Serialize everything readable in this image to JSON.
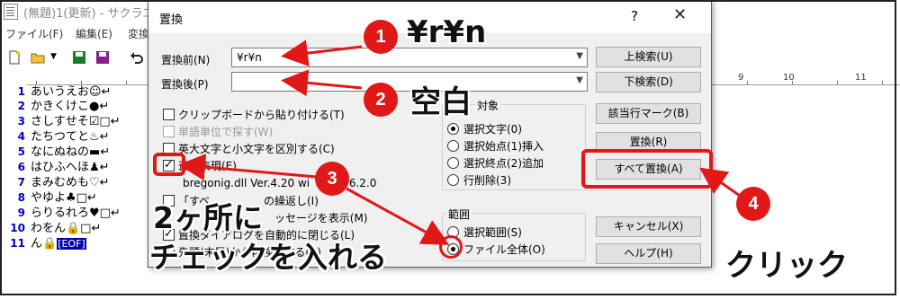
{
  "editor": {
    "title": "(無題)1(更新) - サクラエ",
    "menu": [
      "ファイル(F)",
      "編集(E)",
      "変換"
    ],
    "ruler": [
      "9",
      "10",
      "11"
    ],
    "line_numbers": [
      "1",
      "2",
      "3",
      "4",
      "5",
      "6",
      "7",
      "8",
      "9",
      "10",
      "11"
    ],
    "lines": [
      "あいうえお☺↵",
      "かきくけこ●↵",
      "さしすせそ☑□↵",
      "たちつてと♨↵",
      "なにぬねの▬↵",
      "はひふへほ♟↵",
      "まみむめも♡↵",
      "やゆよ♣□↵",
      "らりるれろ♥□↵",
      "わをん🔒□↵",
      "ん🔒"
    ],
    "eof": "[EOF]"
  },
  "dialog": {
    "title": "置換",
    "help": "?",
    "close": "✕",
    "find_label": "置換前(N)",
    "find_value": "¥r¥n",
    "replace_label": "置換後(P)",
    "replace_value": "",
    "buttons": {
      "search_up": "上検索(U)",
      "search_down": "下検索(D)",
      "mark_lines": "該当行マーク(B)",
      "replace": "置換(R)",
      "replace_all": "すべて置換(A)",
      "cancel": "キャンセル(X)",
      "help": "ヘルプ(H)"
    },
    "options": [
      {
        "label": "クリップボードから貼り付ける(T)",
        "checked": false,
        "disabled": false
      },
      {
        "label": "単語単位で探す(W)",
        "checked": false,
        "disabled": true
      },
      {
        "label": "英大文字と小文字を区別する(C)",
        "checked": false,
        "disabled": false
      },
      {
        "label": "正規表現(E)",
        "checked": true,
        "disabled": false
      },
      {
        "label": "bregonig.dll Ver.4.20 wi",
        "checked": null,
        "disabled": false
      },
      {
        "label": "mo 6.2.0",
        "checked": null,
        "disabled": false
      },
      {
        "label": "「すべ",
        "checked": false,
        "disabled": false
      },
      {
        "label": "の繰返し(I)",
        "checked": null,
        "disabled": false
      },
      {
        "label": "ッセージを表示(M)",
        "checked": null,
        "disabled": false
      },
      {
        "label": "置換ダイアログを自動的に閉じる(L)",
        "checked": true,
        "disabled": false
      },
      {
        "label": "先頭(末尾)から再検索する(Z)",
        "checked": true,
        "disabled": false
      }
    ],
    "target_group": {
      "title": "対象",
      "options": [
        "選択文字(0)",
        "選択始点(1)挿入",
        "選択終点(2)追加",
        "行削除(3)"
      ],
      "selected": 0
    },
    "scope_group": {
      "title": "範囲",
      "options": [
        "選択範囲(S)",
        "ファイル全体(O)"
      ],
      "selected": 1
    }
  },
  "annotations": {
    "step1_number": "1",
    "step1_text": "¥r¥n",
    "step2_number": "2",
    "step2_text": "空白",
    "step3_number": "3",
    "step3_text_line1": "2ヶ所に",
    "step3_text_line2": "チェックを入れる",
    "step4_number": "4",
    "step4_text": "クリック",
    "accent_color": "#e01818"
  }
}
